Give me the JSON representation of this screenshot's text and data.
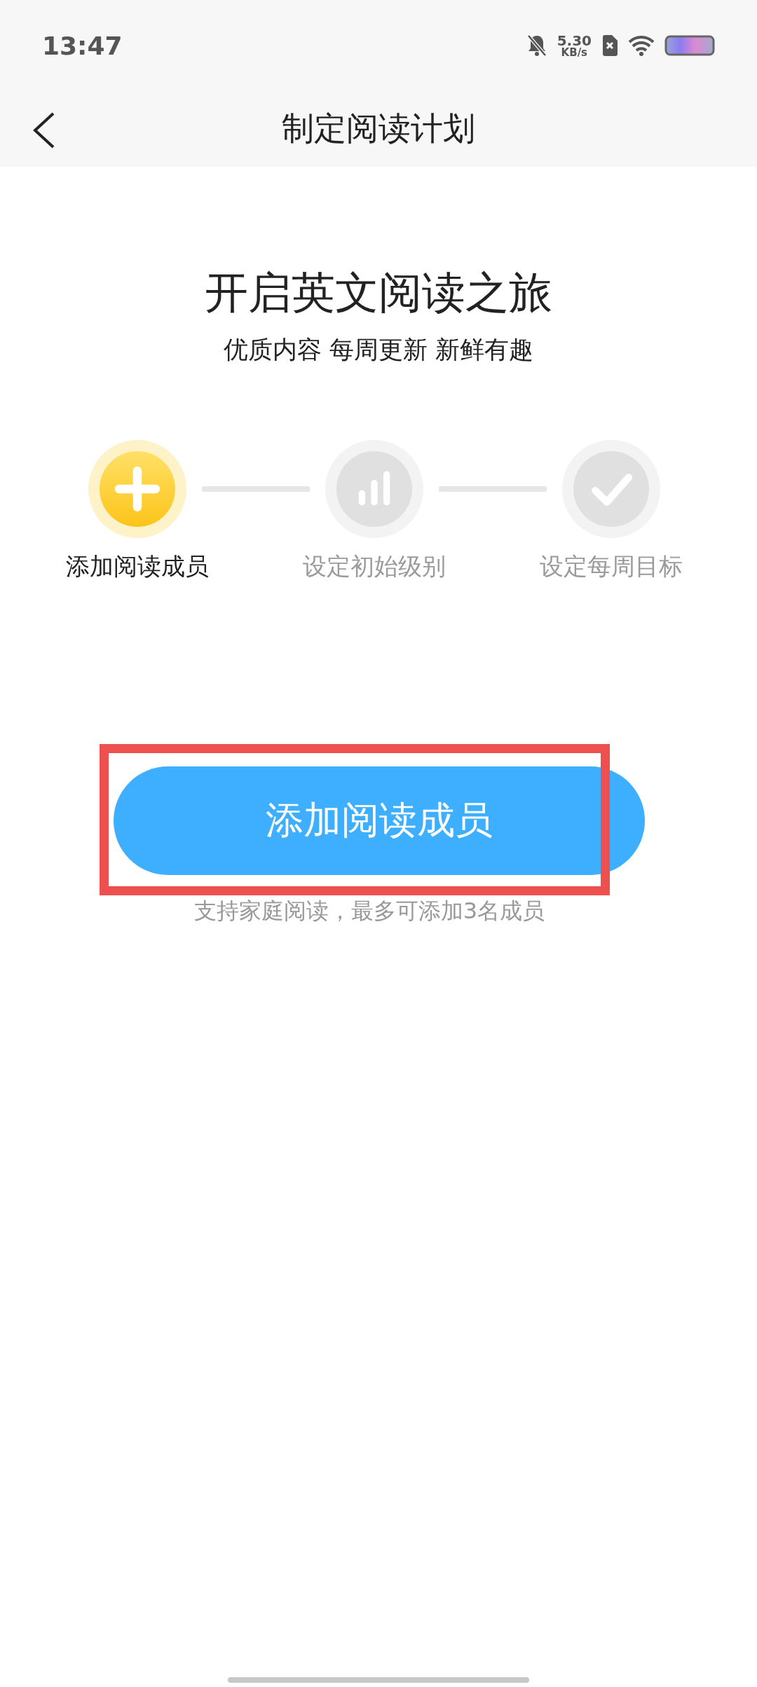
{
  "status_bar": {
    "time": "13:47",
    "net_speed": "5.30",
    "net_unit": "KB/s"
  },
  "header": {
    "title": "制定阅读计划"
  },
  "hero": {
    "title": "开启英文阅读之旅",
    "subtitle": "优质内容 每周更新 新鲜有趣"
  },
  "steps": [
    {
      "label": "添加阅读成员",
      "kind": "plus",
      "selected": true
    },
    {
      "label": "设定初始级别",
      "kind": "bars",
      "selected": false
    },
    {
      "label": "设定每周目标",
      "kind": "check",
      "selected": false
    }
  ],
  "action": {
    "button": "添加阅读成员",
    "highlighted": true,
    "note": "支持家庭阅读，最多可添加3名成员"
  }
}
